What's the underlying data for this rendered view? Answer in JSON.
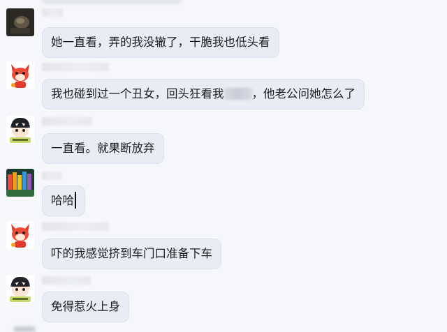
{
  "messages": [
    {
      "avatar": "dark-photo-avatar",
      "text": "她一直看，弄的我没辙了，干脆我也低头看"
    },
    {
      "avatar": "fox-avatar",
      "text_before": "我也碰到过一个丑女，回头狂看我",
      "text_after": "，他老公问她怎么了"
    },
    {
      "avatar": "cartoon-boy-avatar",
      "text": "一直看。就果断放弃"
    },
    {
      "avatar": "colored-pencils-avatar",
      "text": "哈哈"
    },
    {
      "avatar": "fox-avatar",
      "text": "吓的我感觉挤到车门口准备下车"
    },
    {
      "avatar": "cartoon-boy-avatar",
      "text": "免得惹火上身"
    }
  ],
  "colors": {
    "background": "#f6f7fa",
    "bubble": "#e8ecf4",
    "text": "#1d1d1d"
  }
}
